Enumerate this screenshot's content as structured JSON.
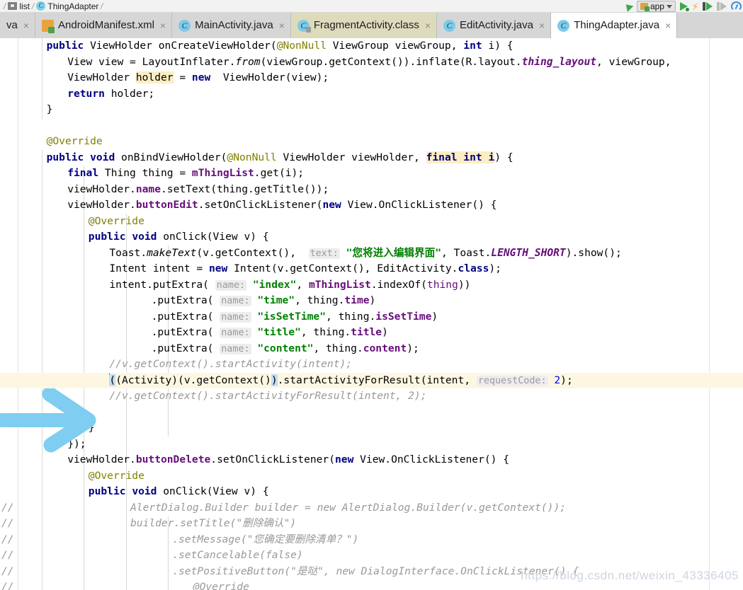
{
  "breadcrumb": {
    "items": [
      {
        "label": "list",
        "icon": "folder-icon"
      },
      {
        "label": "ThingAdapter",
        "icon": "class-icon"
      }
    ],
    "separator": "/"
  },
  "toolbar": {
    "module_label": "app",
    "module_icon": "android-module-icon",
    "dropdown_icon": "chevron-down-icon",
    "make_icon": "make-project-icon",
    "run_icon": "run-icon",
    "apply_changes_icon": "apply-changes-icon",
    "debug_icon": "debug-icon",
    "step_icon": "step-over-icon",
    "profiler_icon": "profiler-icon"
  },
  "tabs": [
    {
      "label": "va",
      "icon": "java-file-icon",
      "state": "clipped",
      "close": "×"
    },
    {
      "label": "AndroidManifest.xml",
      "icon": "xml-file-icon",
      "state": "normal",
      "close": "×"
    },
    {
      "label": "MainActivity.java",
      "icon": "java-file-icon",
      "state": "normal",
      "close": "×"
    },
    {
      "label": "FragmentActivity.class",
      "icon": "class-file-icon",
      "state": "highlight",
      "close": "×"
    },
    {
      "label": "EditActivity.java",
      "icon": "java-file-icon",
      "state": "normal",
      "close": "×"
    },
    {
      "label": "ThingAdapter.java",
      "icon": "java-file-icon",
      "state": "active",
      "close": "×"
    }
  ],
  "editor": {
    "language": "java",
    "file": "ThingAdapter.java",
    "highlighted_line_index": 21,
    "colors": {
      "keyword": "#000080",
      "annotation": "#808000",
      "field": "#660e7a",
      "string": "#008000",
      "comment": "#999999",
      "number": "#0000ff",
      "highlight_line_bg": "#fdf7e2",
      "selection_bg": "#c5ddf5",
      "identifier_highlight_bg": "#fbeec3",
      "param_hint_bg": "#ededed",
      "param_hint_fg": "#9a9a9a"
    },
    "lines": [
      {
        "indent": 1,
        "tokens": [
          {
            "t": "public",
            "c": "kw"
          },
          {
            "t": " ViewHolder onCreateViewHolder(",
            "c": "plain"
          },
          {
            "t": "@NonNull",
            "c": "ann"
          },
          {
            "t": " ViewGroup viewGroup, ",
            "c": "plain"
          },
          {
            "t": "int",
            "c": "kw"
          },
          {
            "t": " i) {",
            "c": "plain"
          }
        ]
      },
      {
        "indent": 2,
        "tokens": [
          {
            "t": "View view = LayoutInflater.",
            "c": "plain"
          },
          {
            "t": "from",
            "c": "meth-i"
          },
          {
            "t": "(viewGroup.getContext()).inflate(R.layout.",
            "c": "plain"
          },
          {
            "t": "thing_layout",
            "c": "stat"
          },
          {
            "t": ", viewGroup,",
            "c": "plain"
          }
        ]
      },
      {
        "indent": 2,
        "tokens": [
          {
            "t": "ViewHolder ",
            "c": "plain"
          },
          {
            "t": "holder",
            "c": "ident-hl"
          },
          {
            "t": " = ",
            "c": "plain"
          },
          {
            "t": "new",
            "c": "kw"
          },
          {
            "t": "  ViewHolder(view);",
            "c": "plain"
          }
        ]
      },
      {
        "indent": 2,
        "tokens": [
          {
            "t": "return",
            "c": "kw"
          },
          {
            "t": " holder;",
            "c": "plain"
          }
        ]
      },
      {
        "indent": 1,
        "tokens": [
          {
            "t": "}",
            "c": "plain"
          }
        ]
      },
      {
        "indent": 0,
        "tokens": []
      },
      {
        "indent": 1,
        "tokens": [
          {
            "t": "@Override",
            "c": "ann"
          }
        ]
      },
      {
        "indent": 1,
        "tokens": [
          {
            "t": "public",
            "c": "kw"
          },
          {
            "t": " ",
            "c": "plain"
          },
          {
            "t": "void",
            "c": "kw"
          },
          {
            "t": " onBindViewHolder(",
            "c": "plain"
          },
          {
            "t": "@NonNull",
            "c": "ann"
          },
          {
            "t": " ViewHolder viewHolder, ",
            "c": "plain"
          },
          {
            "t": "final int i",
            "c": "kw ident-hl"
          },
          {
            "t": ") {",
            "c": "plain"
          }
        ]
      },
      {
        "indent": 2,
        "tokens": [
          {
            "t": "final",
            "c": "kw"
          },
          {
            "t": " Thing thing = ",
            "c": "plain"
          },
          {
            "t": "mThingList",
            "c": "fld"
          },
          {
            "t": ".get(i);",
            "c": "plain"
          }
        ]
      },
      {
        "indent": 2,
        "tokens": [
          {
            "t": "viewHolder.",
            "c": "plain"
          },
          {
            "t": "name",
            "c": "fld"
          },
          {
            "t": ".setText(thing.getTitle());",
            "c": "plain"
          }
        ]
      },
      {
        "indent": 2,
        "tokens": [
          {
            "t": "viewHolder.",
            "c": "plain"
          },
          {
            "t": "buttonEdit",
            "c": "fld"
          },
          {
            "t": ".setOnClickListener(",
            "c": "plain"
          },
          {
            "t": "new",
            "c": "kw"
          },
          {
            "t": " View.OnClickListener() {",
            "c": "plain"
          }
        ]
      },
      {
        "indent": 3,
        "tokens": [
          {
            "t": "@Override",
            "c": "ann"
          }
        ]
      },
      {
        "indent": 3,
        "tokens": [
          {
            "t": "public",
            "c": "kw"
          },
          {
            "t": " ",
            "c": "plain"
          },
          {
            "t": "void",
            "c": "kw"
          },
          {
            "t": " onClick(View v) {",
            "c": "plain"
          }
        ]
      },
      {
        "indent": 4,
        "tokens": [
          {
            "t": "Toast.",
            "c": "plain"
          },
          {
            "t": "makeText",
            "c": "meth-i"
          },
          {
            "t": "(v.getContext(),  ",
            "c": "plain"
          },
          {
            "t": "text:",
            "c": "hint"
          },
          {
            "t": " \"您将进入编辑界面\"",
            "c": "str"
          },
          {
            "t": ", Toast.",
            "c": "plain"
          },
          {
            "t": "LENGTH_SHORT",
            "c": "stat"
          },
          {
            "t": ").show();",
            "c": "plain"
          }
        ]
      },
      {
        "indent": 4,
        "tokens": [
          {
            "t": "Intent intent = ",
            "c": "plain"
          },
          {
            "t": "new",
            "c": "kw"
          },
          {
            "t": " Intent(v.getContext(), EditActivity.",
            "c": "plain"
          },
          {
            "t": "class",
            "c": "kw"
          },
          {
            "t": ");",
            "c": "plain"
          }
        ]
      },
      {
        "indent": 4,
        "tokens": [
          {
            "t": "intent.putExtra( ",
            "c": "plain"
          },
          {
            "t": "name:",
            "c": "hint"
          },
          {
            "t": " \"index\"",
            "c": "str"
          },
          {
            "t": ", ",
            "c": "plain"
          },
          {
            "t": "mThingList",
            "c": "fld"
          },
          {
            "t": ".indexOf(",
            "c": "plain"
          },
          {
            "t": "thing",
            "c": "param"
          },
          {
            "t": "))",
            "c": "plain"
          }
        ]
      },
      {
        "indent": 6,
        "tokens": [
          {
            "t": ".putExtra( ",
            "c": "plain"
          },
          {
            "t": "name:",
            "c": "hint"
          },
          {
            "t": " \"time\"",
            "c": "str"
          },
          {
            "t": ", thing.",
            "c": "plain"
          },
          {
            "t": "time",
            "c": "fld"
          },
          {
            "t": ")",
            "c": "plain"
          }
        ]
      },
      {
        "indent": 6,
        "tokens": [
          {
            "t": ".putExtra( ",
            "c": "plain"
          },
          {
            "t": "name:",
            "c": "hint"
          },
          {
            "t": " \"isSetTime\"",
            "c": "str"
          },
          {
            "t": ", thing.",
            "c": "plain"
          },
          {
            "t": "isSetTime",
            "c": "fld"
          },
          {
            "t": ")",
            "c": "plain"
          }
        ]
      },
      {
        "indent": 6,
        "tokens": [
          {
            "t": ".putExtra( ",
            "c": "plain"
          },
          {
            "t": "name:",
            "c": "hint"
          },
          {
            "t": " \"title\"",
            "c": "str"
          },
          {
            "t": ", thing.",
            "c": "plain"
          },
          {
            "t": "title",
            "c": "fld"
          },
          {
            "t": ")",
            "c": "plain"
          }
        ]
      },
      {
        "indent": 6,
        "tokens": [
          {
            "t": ".putExtra( ",
            "c": "plain"
          },
          {
            "t": "name:",
            "c": "hint"
          },
          {
            "t": " \"content\"",
            "c": "str"
          },
          {
            "t": ", thing.",
            "c": "plain"
          },
          {
            "t": "content",
            "c": "fld"
          },
          {
            "t": ");",
            "c": "plain"
          }
        ]
      },
      {
        "indent": 4,
        "tokens": [
          {
            "t": "//v.getContext().startActivity(intent);",
            "c": "cmt"
          }
        ]
      },
      {
        "indent": 4,
        "highlight": true,
        "caret": true,
        "tokens": [
          {
            "t": "(",
            "c": "sel-brace"
          },
          {
            "t": "(Activity)(v.getContext()",
            "c": "plain"
          },
          {
            "t": ")",
            "c": "sel-brace"
          },
          {
            "t": ".startActivityForResult(intent, ",
            "c": "plain"
          },
          {
            "t": "requestCode:",
            "c": "hint"
          },
          {
            "t": " ",
            "c": "plain"
          },
          {
            "t": "2",
            "c": "num"
          },
          {
            "t": ");",
            "c": "plain"
          }
        ]
      },
      {
        "indent": 4,
        "tokens": [
          {
            "t": "//v.getContext().startActivityForResult(intent, 2);",
            "c": "cmt"
          }
        ]
      },
      {
        "indent": 0,
        "tokens": []
      },
      {
        "indent": 3,
        "tokens": [
          {
            "t": "}",
            "c": "plain"
          }
        ]
      },
      {
        "indent": 2,
        "tokens": [
          {
            "t": "});",
            "c": "plain"
          }
        ]
      },
      {
        "indent": 2,
        "tokens": [
          {
            "t": "viewHolder.",
            "c": "plain"
          },
          {
            "t": "buttonDelete",
            "c": "fld"
          },
          {
            "t": ".setOnClickListener(",
            "c": "plain"
          },
          {
            "t": "new",
            "c": "kw"
          },
          {
            "t": " View.OnClickListener() {",
            "c": "plain"
          }
        ]
      },
      {
        "indent": 3,
        "tokens": [
          {
            "t": "@Override",
            "c": "ann"
          }
        ]
      },
      {
        "indent": 3,
        "tokens": [
          {
            "t": "public",
            "c": "kw"
          },
          {
            "t": " ",
            "c": "plain"
          },
          {
            "t": "void",
            "c": "kw"
          },
          {
            "t": " onClick(View v) {",
            "c": "plain"
          }
        ]
      },
      {
        "indent": 5,
        "lead": "//",
        "tokens": [
          {
            "t": "AlertDialog.Builder builder = new AlertDialog.Builder(v.getContext());",
            "c": "cmt"
          }
        ]
      },
      {
        "indent": 5,
        "lead": "//",
        "tokens": [
          {
            "t": "builder.setTitle(\"删除确认\")",
            "c": "cmt"
          }
        ]
      },
      {
        "indent": 7,
        "lead": "//",
        "tokens": [
          {
            "t": ".setMessage(\"您确定要删除清单？\")",
            "c": "cmt"
          }
        ]
      },
      {
        "indent": 7,
        "lead": "//",
        "tokens": [
          {
            "t": ".setCancelable(false)",
            "c": "cmt"
          }
        ]
      },
      {
        "indent": 7,
        "lead": "//",
        "tokens": [
          {
            "t": ".setPositiveButton(\"是哒\", new DialogInterface.OnClickListener() {",
            "c": "cmt"
          }
        ]
      },
      {
        "indent": 8,
        "lead": "//",
        "tokens": [
          {
            "t": "@Override",
            "c": "cmt"
          }
        ]
      }
    ]
  },
  "annotation": {
    "arrow_color": "#7fcdf0",
    "arrow_target": "highlighted-code-line"
  },
  "watermark": {
    "text": "https://blog.csdn.net/weixin_43336405"
  }
}
